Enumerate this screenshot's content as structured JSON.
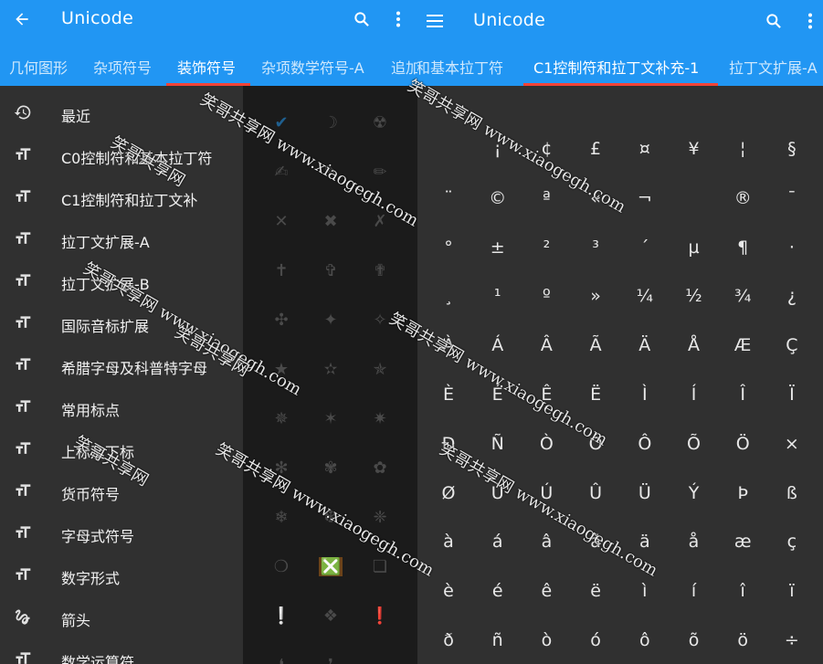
{
  "left": {
    "title": "Unicode",
    "tabs": [
      "几何图形",
      "杂项符号",
      "装饰符号",
      "杂项数学符号-A",
      "追加"
    ],
    "active_tab": 2,
    "drawer_items": [
      {
        "icon": "history",
        "label": "最近"
      },
      {
        "icon": "text-size",
        "label": "C0控制符和基本拉丁符"
      },
      {
        "icon": "text-size",
        "label": "C1控制符和拉丁文补"
      },
      {
        "icon": "text-size",
        "label": "拉丁文扩展-A"
      },
      {
        "icon": "text-size",
        "label": "拉丁文扩展-B"
      },
      {
        "icon": "text-size",
        "label": "国际音标扩展"
      },
      {
        "icon": "text-size",
        "label": "希腊字母及科普特字母"
      },
      {
        "icon": "text-size",
        "label": "常用标点"
      },
      {
        "icon": "text-size",
        "label": "上标及下标"
      },
      {
        "icon": "text-size",
        "label": "货币符号"
      },
      {
        "icon": "text-size",
        "label": "字母式符号"
      },
      {
        "icon": "text-size",
        "label": "数字形式"
      },
      {
        "icon": "gesture",
        "label": "箭头"
      },
      {
        "icon": "text-size",
        "label": "数学运算符"
      }
    ],
    "background_symbols": [
      [
        "✔",
        "☽",
        "☢"
      ],
      [
        "✍",
        "✎",
        "✏"
      ],
      [
        "✕",
        "✖",
        "✗"
      ],
      [
        "✝",
        "✞",
        "✟"
      ],
      [
        "✣",
        "✦",
        "✧"
      ],
      [
        "★",
        "✫",
        "✯"
      ],
      [
        "✵",
        "✶",
        "✷"
      ],
      [
        "✻",
        "✾",
        "✿"
      ],
      [
        "❄",
        "❆",
        "❈"
      ],
      [
        "❍",
        "❎",
        "❏"
      ],
      [
        "❕",
        "❖",
        "❗"
      ],
      [
        "❛",
        "❜",
        ""
      ]
    ]
  },
  "right": {
    "title": "Unicode",
    "tabs": [
      "和基本拉丁符",
      "C1控制符和拉丁文补充-1",
      "拉丁文扩展-A"
    ],
    "active_tab": 1,
    "chars": [
      [
        " ",
        "¡",
        "¢",
        "£",
        "¤",
        "¥",
        "¦",
        "§"
      ],
      [
        "¨",
        "©",
        "ª",
        "«",
        "¬",
        "­",
        "®",
        "¯"
      ],
      [
        "°",
        "±",
        "²",
        "³",
        "´",
        "µ",
        "¶",
        "·"
      ],
      [
        "¸",
        "¹",
        "º",
        "»",
        "¼",
        "½",
        "¾",
        "¿"
      ],
      [
        "À",
        "Á",
        "Â",
        "Ã",
        "Ä",
        "Å",
        "Æ",
        "Ç"
      ],
      [
        "È",
        "É",
        "Ê",
        "Ë",
        "Ì",
        "Í",
        "Î",
        "Ï"
      ],
      [
        "Ð",
        "Ñ",
        "Ò",
        "Ó",
        "Ô",
        "Õ",
        "Ö",
        "×"
      ],
      [
        "Ø",
        "Ù",
        "Ú",
        "Û",
        "Ü",
        "Ý",
        "Þ",
        "ß"
      ],
      [
        "à",
        "á",
        "â",
        "ã",
        "ä",
        "å",
        "æ",
        "ç"
      ],
      [
        "è",
        "é",
        "ê",
        "ë",
        "ì",
        "í",
        "î",
        "ï"
      ],
      [
        "ð",
        "ñ",
        "ò",
        "ó",
        "ô",
        "õ",
        "ö",
        "÷"
      ]
    ]
  },
  "watermark": {
    "cn": "笑哥共享网",
    "url": "www.xiaogegh.com"
  },
  "colors": {
    "appbar": "#2196f3",
    "indicator": "#f44336",
    "accent_check": "#2196f3",
    "highlight_x": "#ff9800"
  }
}
